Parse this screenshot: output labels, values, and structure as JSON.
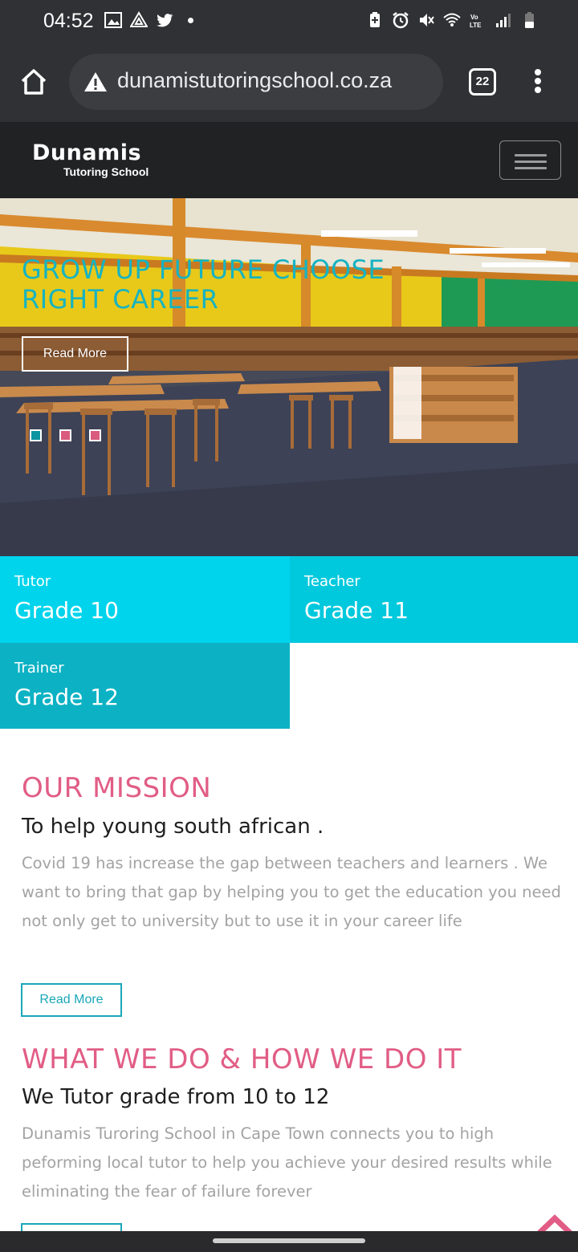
{
  "status_bar": {
    "time": "04:52"
  },
  "browser": {
    "url": "dunamistutoringschool.co.za",
    "tab_count": "22"
  },
  "site": {
    "logo_main": "Dunamis",
    "logo_sub": "Tutoring School"
  },
  "hero": {
    "title": "GROW UP FUTURE CHOOSE RIGHT CAREER",
    "button": "Read More",
    "slides": 3,
    "active_slide": 1,
    "dot_colors": [
      "#0e95a2",
      "#d95c7f",
      "#d95c7f"
    ]
  },
  "cards": [
    {
      "label": "Tutor",
      "value": "Grade 10"
    },
    {
      "label": "Teacher",
      "value": "Grade 11"
    },
    {
      "label": "Trainer",
      "value": "Grade 12"
    }
  ],
  "mission": {
    "title": "OUR MISSION",
    "subtitle": "To help young south african .",
    "body": "Covid 19 has increase the gap between teachers and learners . We want to bring that gap by helping you to get the education you need not only get to university but to use it in your career life",
    "button": "Read More"
  },
  "what_we_do": {
    "title": "WHAT WE DO & HOW WE DO IT",
    "subtitle": "We Tutor grade from 10 to 12",
    "body": "Dunamis Turoring School in Cape Town connects you to high peforming local tutor to help you achieve your desired results while eliminating the fear of failure forever"
  },
  "colors": {
    "accent_pink": "#e15d85",
    "accent_teal": "#1aa7b8",
    "card_cyan": "#00d4ec"
  }
}
